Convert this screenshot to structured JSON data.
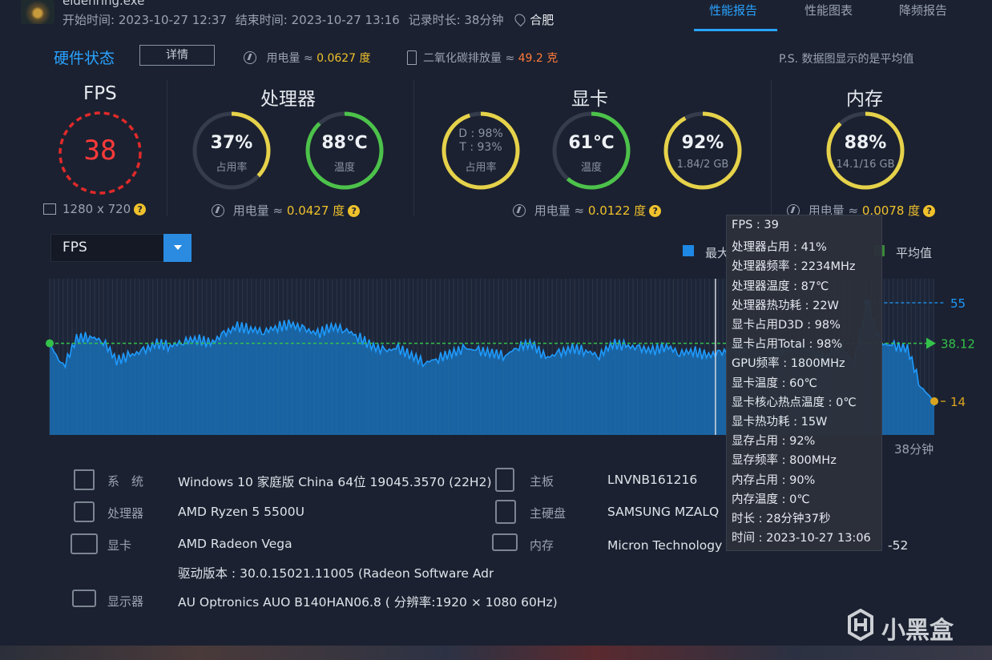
{
  "header": {
    "exe_name": "eldenring.exe",
    "start_time": "开始时间: 2023-10-27 12:37",
    "end_time": "结束时间: 2023-10-27 13:16",
    "duration": "记录时长: 38分钟",
    "city": "合肥",
    "tabs": [
      {
        "label": "性能报告",
        "active": true
      },
      {
        "label": "性能图表",
        "active": false
      },
      {
        "label": "降频报告",
        "active": false
      }
    ]
  },
  "status_bar": {
    "title": "硬件状态",
    "detail_button": "详情",
    "power_label": "用电量 ≈ ",
    "power_value": "0.0627 度",
    "co2_label": "二氧化碳排放量 ≈ ",
    "co2_value": "49.2 克",
    "note": "P.S. 数据图显示的是平均值"
  },
  "sections": {
    "fps": {
      "title": "FPS",
      "value": "38",
      "resolution": "1280 x 720"
    },
    "cpu": {
      "title": "处理器",
      "usage_value": "37%",
      "usage_label": "占用率",
      "usage_level": 0.37,
      "temp_value": "88℃",
      "temp_label": "温度",
      "temp_level": 0.88,
      "power_label": "用电量 ≈ ",
      "power_value": "0.0427 度"
    },
    "gpu": {
      "title": "显卡",
      "d_usage": "D : 98%",
      "t_usage": "T : 93%",
      "usage_label": "占用率",
      "usage_level": 0.95,
      "temp_value": "61℃",
      "temp_label": "温度",
      "temp_level": 0.61,
      "vram_value": "92%",
      "vram_label": "1.84/2 GB",
      "vram_level": 0.92,
      "power_label": "用电量 ≈ ",
      "power_value": "0.0122 度"
    },
    "memory": {
      "title": "内存",
      "usage_value": "88%",
      "usage_label": "14.1/16 GB",
      "usage_level": 0.88,
      "power_label": "用电量 ≈ ",
      "power_value": "0.0078 度"
    }
  },
  "chart_controls": {
    "select_value": "FPS",
    "legend": [
      {
        "label": "最大",
        "color": "#1e88e5"
      },
      {
        "label": "平均值",
        "color": "#3a8a3a"
      }
    ],
    "time_end": "38分钟"
  },
  "chart_data": {
    "type": "area",
    "ylim": [
      0,
      65
    ],
    "xlim_minutes": [
      0,
      38
    ],
    "max_value": 55,
    "avg_value": 38.12,
    "min_value": 14,
    "max_label": "55",
    "avg_label": "38.12",
    "min_label": "14",
    "hover_marker_minute": 28.6,
    "series": [
      {
        "values": [
          38,
          28,
          40,
          41,
          39,
          31,
          33,
          35,
          38,
          37,
          39,
          40,
          38,
          42,
          45,
          44,
          43,
          45,
          46,
          44,
          42,
          45,
          44,
          41,
          37,
          35,
          36,
          33,
          30,
          32,
          34,
          36,
          35,
          34,
          33,
          37,
          38,
          32,
          34,
          36,
          35,
          33,
          38,
          37,
          36,
          35,
          37,
          34,
          35,
          33,
          34,
          36,
          37,
          38,
          35,
          36,
          38,
          34,
          33,
          37,
          30,
          55,
          38,
          37,
          36,
          20,
          14
        ]
      }
    ],
    "colors": {
      "fill": "#1a6fb5",
      "line": "#1e9bff",
      "avg": "#34c24b",
      "min": "#d9a51f"
    }
  },
  "tooltip": {
    "lines": [
      "FPS : 39",
      "处理器占用 : 41%",
      "处理器频率 : 2234MHz",
      "处理器温度 : 87℃",
      "处理器热功耗 : 22W",
      "显卡占用D3D : 98%",
      "显卡占用Total : 98%",
      "GPU频率 : 1800MHz",
      "显卡温度 : 60℃",
      "显卡核心热点温度 : 0℃",
      "显卡热功耗 : 15W",
      "显存占用 : 92%",
      "显存频率 : 800MHz",
      "内存占用 : 90%",
      "内存温度 : 0℃",
      "时长 : 28分钟37秒",
      "时间 : 2023-10-27 13:06"
    ]
  },
  "system_info": {
    "os_label": "系　统",
    "os_value": "Windows 10 家庭版 China 64位 19045.3570 (22H2)",
    "cpu_label": "处理器",
    "cpu_value": "AMD Ryzen 5 5500U",
    "gpu_label": "显卡",
    "gpu_value": "AMD Radeon Vega",
    "driver_value": "驱动版本 : 30.0.15021.11005 (Radeon Software Adre",
    "display_label": "显示器",
    "display_value": "AU Optronics AUO B140HAN06.8 ( 分辨率:1920 × 1080 60Hz)",
    "board_label": "主板",
    "board_value": "LNVNB161216",
    "disk_label": "主硬盘",
    "disk_value": "SAMSUNG MZALQ",
    "memory_label": "内存",
    "memory_value": "Micron Technology",
    "memory_value_tail": "-52"
  },
  "watermark": {
    "text": "小黑盒"
  }
}
